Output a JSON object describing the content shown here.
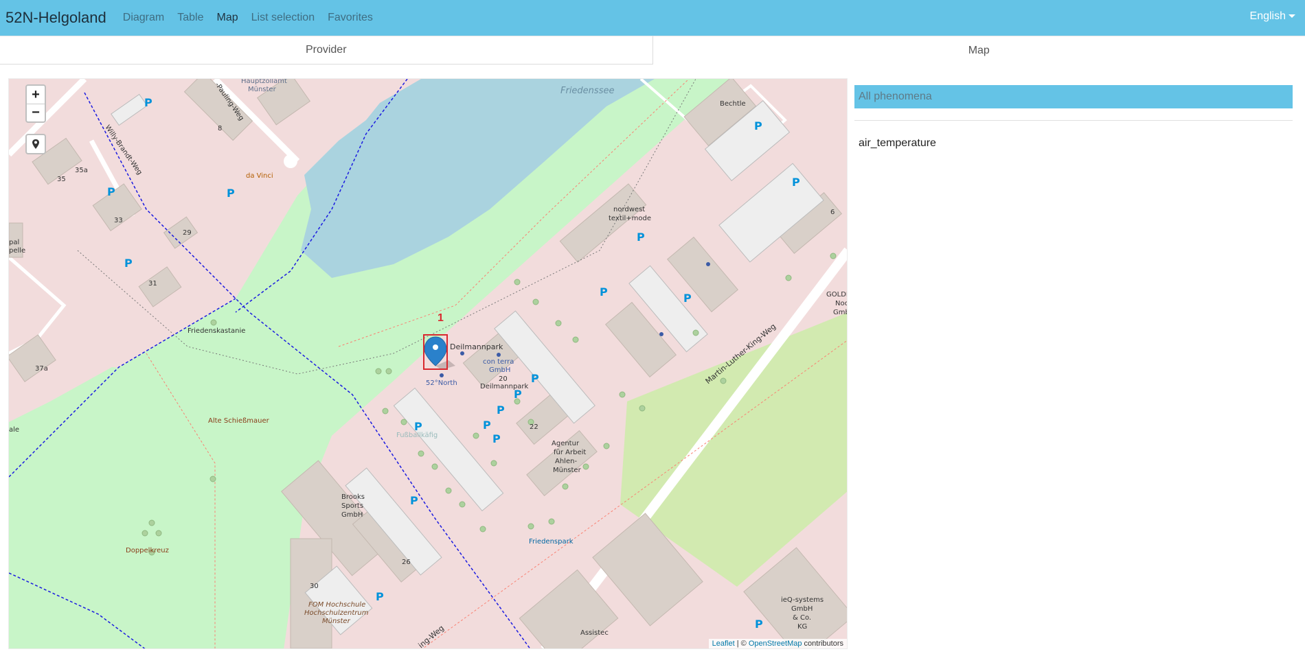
{
  "app": {
    "title": "52N-Helgoland"
  },
  "nav": {
    "items": [
      "Diagram",
      "Table",
      "Map",
      "List selection",
      "Favorites"
    ],
    "language": "English"
  },
  "tabs": {
    "provider": "Provider",
    "map": "Map"
  },
  "map": {
    "zoom_in": "+",
    "zoom_out": "−",
    "marker_number": "1",
    "labels": {
      "friedenssee": "Friedenssee",
      "bechtle": "Bechtle",
      "hauptzollamt1": "Hauptzollamt",
      "hauptzollamt2": "Münster",
      "pauling": "-Pauling-Weg",
      "willy": "Willy-Brandt-Weg",
      "davinci": "da Vinci",
      "nordwest1": "nordwest",
      "nordwest2": "textil+mode",
      "deilmannpark": "Deilmannpark",
      "conterra1": "con terra",
      "conterra2": "GmbH",
      "deil20a": "20",
      "deil20b": "Deilmannpark",
      "north52": "52°North",
      "friedenskastanie": "Friedenskastanie",
      "mlk": "Martin-Luther-King-Weg",
      "schiessmauer": "Alte Schießmauer",
      "agentur1": "Agentur",
      "agentur2": "für Arbeit",
      "agentur3": "Ahlen-",
      "agentur4": "Münster",
      "brooks1": "Brooks",
      "brooks2": "Sports",
      "brooks3": "GmbH",
      "friedenspark": "Friedenspark",
      "doppelkreuz": "Doppelkreuz",
      "fom1": "FOM Hochschule",
      "fom2": "Hochschulzentrum",
      "fom3": "Münster",
      "ieq1": "ieQ-systems",
      "ieq2": "GmbH",
      "ieq3": "& Co.",
      "ieq4": "KG",
      "assistec": "Assistec",
      "paulingBottom": "ing-Weg",
      "bolzplatz": "Fußballkäfig",
      "goldi1": "GOLDI",
      "goldi2": "Noc",
      "goldi3": "Gmb",
      "n35": "35",
      "n35a": "35a",
      "n33": "33",
      "n29": "29",
      "n31": "31",
      "n8": "8",
      "n37a": "37a",
      "n6": "6",
      "n22": "22",
      "n26": "26",
      "n30": "30",
      "pelle1": "pal",
      "pelle2": "pelle",
      "ale": "ale"
    }
  },
  "attribution": {
    "leaflet": "Leaflet",
    "sep": " | © ",
    "osm": "OpenStreetMap",
    "contrib": " contributors"
  },
  "panel": {
    "header": "All phenomena",
    "items": [
      "air_temperature"
    ]
  },
  "colors": {
    "accent": "#64c3e6",
    "marker": "#2a81cb",
    "highlight": "#d9282e"
  }
}
